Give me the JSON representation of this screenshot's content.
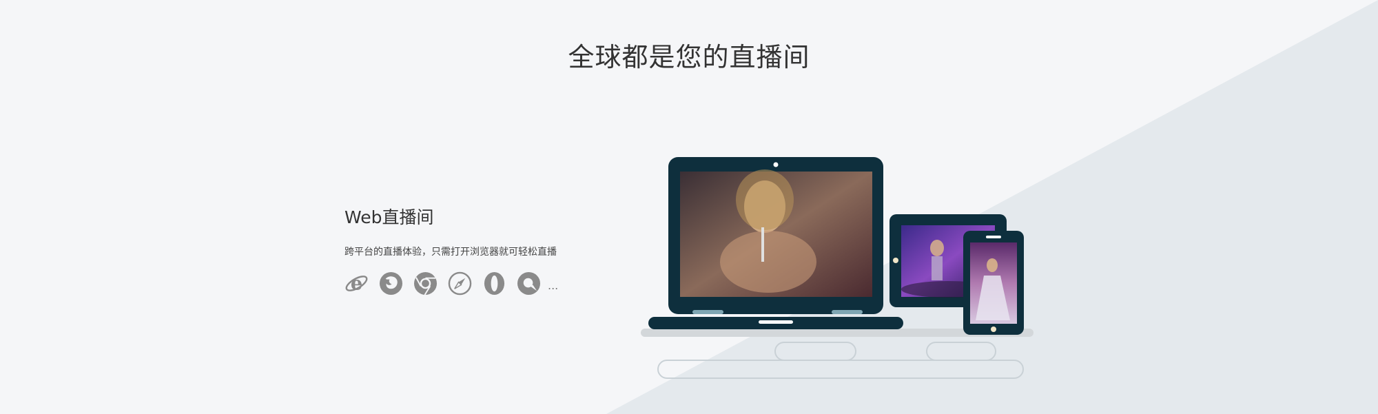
{
  "page": {
    "title": "全球都是您的直播间"
  },
  "feature": {
    "title": "Web直播间",
    "description": "跨平台的直播体验，只需打开浏览器就可轻松直播",
    "more_label": "..."
  },
  "browsers": [
    {
      "name": "ie-icon"
    },
    {
      "name": "firefox-icon"
    },
    {
      "name": "chrome-icon"
    },
    {
      "name": "safari-icon"
    },
    {
      "name": "opera-icon"
    },
    {
      "name": "qq-browser-icon"
    }
  ],
  "colors": {
    "background": "#f5f6f8",
    "triangle": "#e4e9ed",
    "device_frame": "#0e2f3d",
    "icon_gray": "#8a8a8a",
    "outline": "#c9d1d6"
  }
}
